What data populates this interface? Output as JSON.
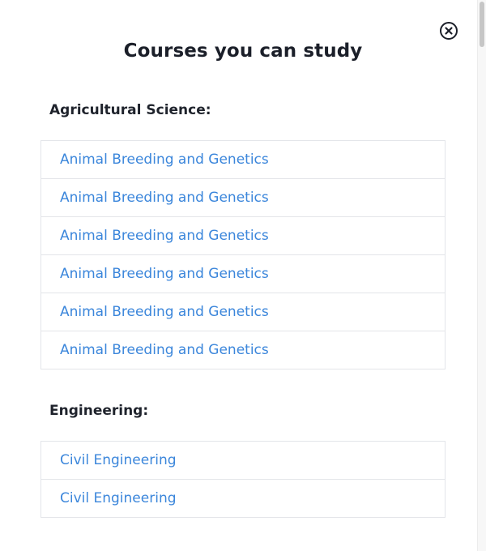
{
  "modal": {
    "title": "Courses you can study",
    "close_icon": "circle-x-icon"
  },
  "sections": [
    {
      "heading": "Agricultural Science:",
      "courses": [
        "Animal Breeding and Genetics",
        "Animal Breeding and Genetics",
        "Animal Breeding and Genetics",
        "Animal Breeding and Genetics",
        "Animal Breeding and Genetics",
        "Animal Breeding and Genetics"
      ]
    },
    {
      "heading": "Engineering:",
      "courses": [
        "Civil Engineering",
        "Civil Engineering"
      ]
    }
  ],
  "colors": {
    "link": "#3b86db",
    "heading": "#1b1f29",
    "border": "#e3e5e9"
  }
}
